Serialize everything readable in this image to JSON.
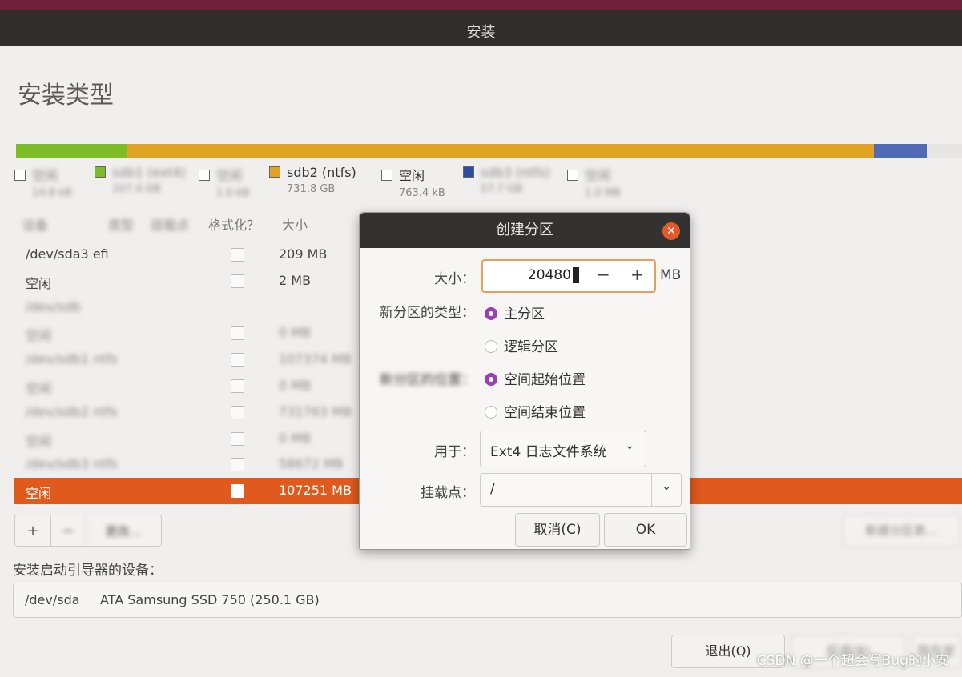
{
  "window": {
    "title": "安装"
  },
  "page": {
    "title": "安装类型"
  },
  "partition_bar": {
    "segments": [
      {
        "color": "#7dbd27",
        "fraction": 0.117
      },
      {
        "color": "#e2a425",
        "fraction": 0.79
      },
      {
        "color": "#4f6bb5",
        "fraction": 0.056
      },
      {
        "color": "#e8e6e3",
        "fraction": 0.037
      }
    ]
  },
  "legend": [
    {
      "label": "空闲",
      "sub": "14.8 kB",
      "color": "#ffffff",
      "blur": true
    },
    {
      "label": "sdb1 (ext4)",
      "sub": "107.4 GB",
      "color": "#7dbd27",
      "blur": true
    },
    {
      "label": "空闲",
      "sub": "1.0 kB",
      "color": "#ffffff",
      "blur": true
    },
    {
      "label": "sdb2 (ntfs)",
      "sub": "731.8 GB",
      "color": "#e2a425",
      "blur": false
    },
    {
      "label": "空闲",
      "sub": "763.4 kB",
      "color": "#ffffff",
      "blur": false
    },
    {
      "label": "sdb3 (ntfs)",
      "sub": "57.7 GB",
      "color": "#2b4fa8",
      "blur": true
    },
    {
      "label": "空闲",
      "sub": "1.0 MB",
      "color": "#ffffff",
      "blur": true
    }
  ],
  "table": {
    "headers": [
      "设备",
      "类型",
      "挂载点",
      "格式化？",
      "大小"
    ],
    "rows": [
      {
        "device": "/dev/sda3  efi",
        "size": "209 MB",
        "blur": false
      },
      {
        "device": "空闲",
        "size": "2 MB",
        "blur": false
      },
      {
        "device": "/dev/sdb",
        "size": "",
        "blur": true
      },
      {
        "device": "空闲",
        "size": "0 MB",
        "blur": true
      },
      {
        "device": "/dev/sdb1  ntfs",
        "size": "107374 MB",
        "blur": true
      },
      {
        "device": "空闲",
        "size": "0 MB",
        "blur": true
      },
      {
        "device": "/dev/sdb2  ntfs",
        "size": "731763 MB",
        "blur": true
      },
      {
        "device": "空闲",
        "size": "0 MB",
        "blur": true
      },
      {
        "device": "/dev/sdb3  ntfs",
        "size": "58672 MB",
        "blur": true
      },
      {
        "device": "空闲",
        "size": "107251 MB",
        "blur": false,
        "selected": true
      }
    ]
  },
  "table_buttons": {
    "add": "+",
    "remove": "−",
    "change": "更改…",
    "new_table": "新建分区表…"
  },
  "boot": {
    "label": "安装启动引导器的设备：",
    "device": "/dev/sda",
    "description": "ATA Samsung SSD 750 (250.1 GB)"
  },
  "bottom_buttons": {
    "quit": "退出(Q)",
    "back": "后退(B)",
    "install": "现在安装(I)"
  },
  "watermark": "CSDN @一个超会写Bug的小安",
  "dialog": {
    "title": "创建分区",
    "size_label": "大小：",
    "size_value": "20480",
    "size_unit": "MB",
    "type_label": "新分区的类型：",
    "type_options": [
      "主分区",
      "逻辑分区"
    ],
    "type_selected": 0,
    "location_label": "新分区的位置：",
    "location_options": [
      "空间起始位置",
      "空间结束位置"
    ],
    "location_selected": 0,
    "use_label": "用于：",
    "use_value": "Ext4 日志文件系统",
    "mount_label": "挂载点：",
    "mount_value": "/",
    "cancel": "取消(C)",
    "ok": "OK"
  }
}
